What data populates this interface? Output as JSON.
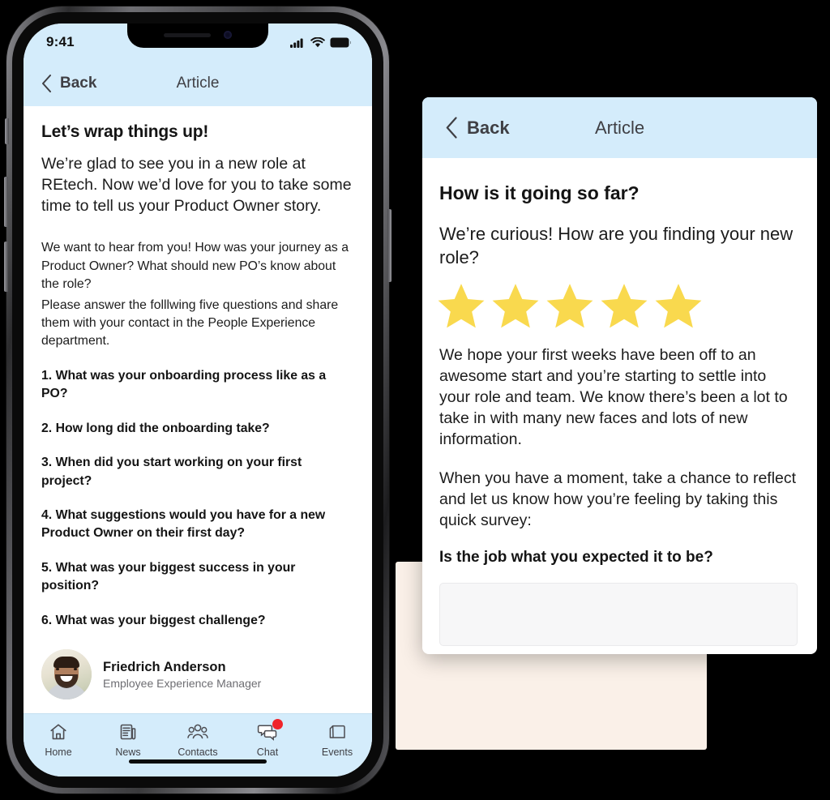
{
  "device": {
    "status_bar": {
      "time": "9:41",
      "icons": [
        "signal-icon",
        "wifi-icon",
        "battery-icon"
      ]
    },
    "home_indicator": true
  },
  "phone_screen": {
    "navbar": {
      "back_label": "Back",
      "title": "Article",
      "back_icon": "chevron-left-icon"
    },
    "article": {
      "title": "Let’s wrap things up!",
      "lead": "We’re glad to see you in a new role at REtech. Now we’d love for you to take some time to tell us your Product Owner story.",
      "paragraphs": [
        "We want to hear from you! How was your journey as a Product Owner? What should new PO’s know about the role?",
        "Please answer the folllwing five questions and share them with your contact in the People Experience department."
      ],
      "questions": [
        "1. What was your onboarding process like as a PO?",
        "2. How long did the onboarding take?",
        "3. When did you start working on your first project?",
        "4. What suggestions would you have for a new Product Owner on their first day?",
        "5. What was your biggest success in your position?",
        "6. What was your biggest challenge?"
      ],
      "author": {
        "name": "Friedrich Anderson",
        "role": "Employee Experience Manager",
        "avatar_icon": "avatar-photo"
      }
    },
    "tabbar": {
      "items": [
        {
          "label": "Home",
          "icon": "home-icon",
          "badge": false
        },
        {
          "label": "News",
          "icon": "news-icon",
          "badge": false
        },
        {
          "label": "Contacts",
          "icon": "contacts-icon",
          "badge": false
        },
        {
          "label": "Chat",
          "icon": "chat-icon",
          "badge": true
        },
        {
          "label": "Events",
          "icon": "folder-icon",
          "badge": false
        }
      ]
    }
  },
  "panel2": {
    "navbar": {
      "back_label": "Back",
      "title": "Article",
      "back_icon": "chevron-left-icon"
    },
    "title": "How is it going so far?",
    "lead": "We’re curious! How are you finding your new role?",
    "rating": {
      "max": 5,
      "filled": 5,
      "icon": "star-icon"
    },
    "paragraphs": [
      "We hope your first weeks have been off to an awesome start and you’re starting to settle into your role and team. We know there’s been a lot to take in with many new faces and lots of new information.",
      "When you have a moment, take a chance to reflect and let us know how you’re feeling by taking this quick survey:"
    ],
    "question": "Is the job what you expected it to be?",
    "answer_input": {
      "value": "",
      "placeholder": ""
    }
  },
  "colors": {
    "header_blue": "#D4ECFB",
    "star_yellow": "#F9D94E",
    "badge_red": "#F0242A",
    "cream_panel": "#FAF0E8",
    "text_dark": "#1c1c1c",
    "text_muted": "#6d6d72"
  }
}
